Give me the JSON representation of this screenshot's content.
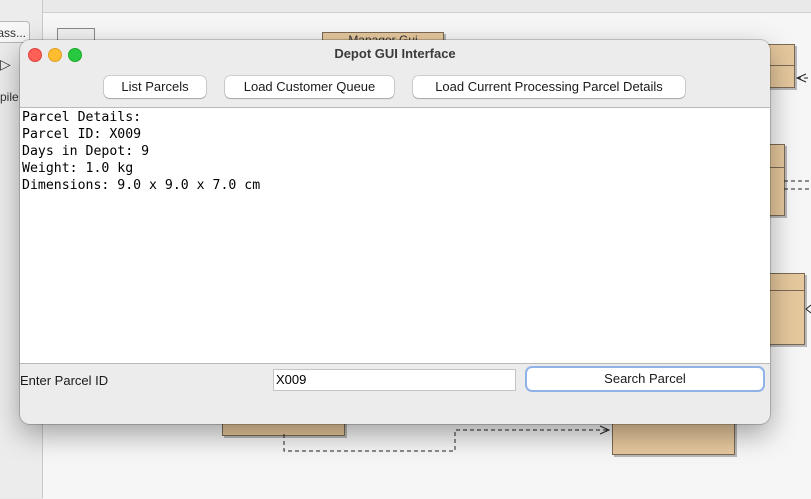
{
  "background": {
    "side_button_1": "ass...",
    "run_icon": "run-triangle-icon",
    "side_label": "pile",
    "top_class_label": "Manager Gui"
  },
  "window": {
    "title": "Depot GUI Interface",
    "buttons": {
      "list_parcels": "List Parcels",
      "load_customer_queue": "Load Customer Queue",
      "load_current_processing": "Load Current Processing Parcel Details"
    },
    "output_lines": [
      "Parcel Details:",
      "Parcel ID: X009",
      "Days in Depot: 9",
      "Weight: 1.0 kg",
      "Dimensions: 9.0 x 9.0 x 7.0 cm"
    ],
    "parcel_id_label": "Enter Parcel ID",
    "parcel_id_value": "X009",
    "search_button": "Search Parcel"
  },
  "colors": {
    "class_fill": "#e6c89d",
    "focus_ring": "#8fb3e8",
    "close": "#fe5f57",
    "minimize": "#febc2e",
    "zoom": "#28c840"
  }
}
